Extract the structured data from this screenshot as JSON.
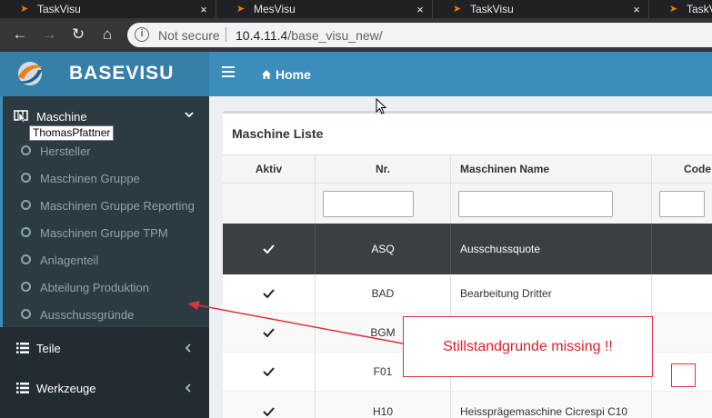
{
  "browser": {
    "tabs": [
      {
        "title": "TaskVisu",
        "close": "×"
      },
      {
        "title": "MesVisu",
        "close": "×"
      },
      {
        "title": "TaskVisu",
        "close": "×"
      },
      {
        "title": "TaskVisu",
        "close": "×"
      }
    ],
    "address": {
      "security": "Not secure",
      "host": "10.4.11.4",
      "path": "/base_visu_new/"
    }
  },
  "app": {
    "brand": "BASEVISU",
    "nav": {
      "home_label": "Home"
    }
  },
  "sidebar": {
    "active_section": "Maschine",
    "tooltip": "ThomasPfattner",
    "sub_items": [
      "Hersteller",
      "Maschinen Gruppe",
      "Maschinen Gruppe Reporting",
      "Maschinen Gruppe TPM",
      "Anlagenteil",
      "Abteilung Produktion",
      "Ausschussgründe"
    ],
    "sections": [
      "Teile",
      "Werkzeuge"
    ]
  },
  "main": {
    "box_title": "Maschine Liste",
    "columns": [
      "Aktiv",
      "Nr.",
      "Maschinen Name",
      "Code"
    ],
    "rows": [
      {
        "aktiv": true,
        "nr": "ASQ",
        "name": "Ausschussquote",
        "code": ""
      },
      {
        "aktiv": true,
        "nr": "BAD",
        "name": "Bearbeitung Dritter",
        "code": ""
      },
      {
        "aktiv": true,
        "nr": "BGM",
        "name": "",
        "code": ""
      },
      {
        "aktiv": true,
        "nr": "F01",
        "name": "",
        "code": ""
      },
      {
        "aktiv": true,
        "nr": "H10",
        "name": "Heissprägemaschine Cicrespi C10",
        "code": ""
      }
    ]
  },
  "annotation": {
    "text": "Stillstandgrunde missing !!",
    "color": "#e0202a"
  },
  "colors": {
    "sidebar": "#222d32",
    "header": "#3c8dbc",
    "logo_bg": "#367fa9",
    "selected_row": "#3a3f44"
  }
}
